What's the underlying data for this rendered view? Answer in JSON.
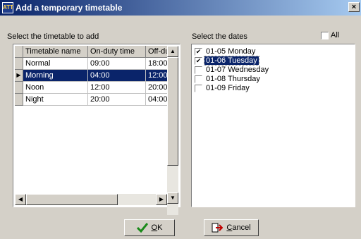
{
  "window": {
    "title": "Add a temporary timetable",
    "close_label": "×",
    "app_icon_text": "ATT"
  },
  "timetable_panel": {
    "label": "Select the timetable to add",
    "columns": [
      "Timetable name",
      "On-duty time",
      "Off-duty time"
    ],
    "rows": [
      {
        "name": "Normal",
        "on": "09:00",
        "off": "18:00",
        "selected": false
      },
      {
        "name": "Morning",
        "on": "04:00",
        "off": "12:00",
        "selected": true
      },
      {
        "name": "Noon",
        "on": "12:00",
        "off": "20:00",
        "selected": false
      },
      {
        "name": "Night",
        "on": "20:00",
        "off": "04:00",
        "selected": false
      }
    ]
  },
  "dates_panel": {
    "label": "Select the dates",
    "all_label": "All",
    "all_checked": false,
    "items": [
      {
        "label": "01-05 Monday",
        "checked": true,
        "selected": false
      },
      {
        "label": "01-06 Tuesday",
        "checked": true,
        "selected": true
      },
      {
        "label": "01-07 Wednesday",
        "checked": false,
        "selected": false
      },
      {
        "label": "01-08 Thursday",
        "checked": false,
        "selected": false
      },
      {
        "label": "01-09 Friday",
        "checked": false,
        "selected": false
      }
    ]
  },
  "buttons": {
    "ok": {
      "accel": "O",
      "rest": "K",
      "icon": "check-icon"
    },
    "cancel": {
      "accel": "C",
      "rest": "ancel",
      "icon": "exit-icon"
    }
  },
  "colors": {
    "selection": "#0a246a",
    "title_start": "#0a246a",
    "title_end": "#a6caf0",
    "face": "#d4d0c8"
  }
}
